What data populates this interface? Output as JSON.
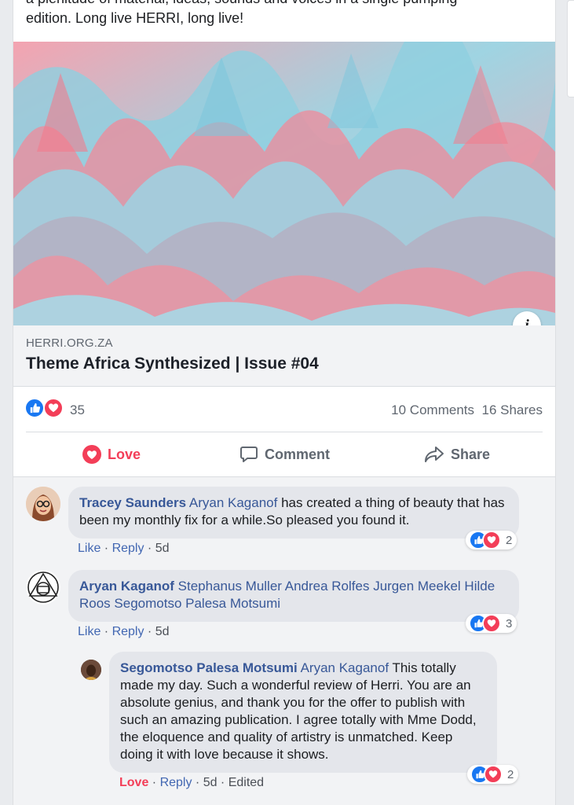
{
  "post": {
    "text_line1": "a plenitude of material, ideas, sounds and voices in a single pumping",
    "text_line2": "edition. Long live HERRI, long live!"
  },
  "link_preview": {
    "domain": "HERRI.ORG.ZA",
    "title": "Theme Africa Synthesized | Issue #04",
    "info_icon": "info-icon",
    "info_label": "i"
  },
  "stats": {
    "reaction_count": "35",
    "comments": "10 Comments",
    "shares": "16 Shares"
  },
  "actions": {
    "love": "Love",
    "comment": "Comment",
    "share": "Share"
  },
  "comments": [
    {
      "author": "Tracey Saunders",
      "tag": "Aryan Kaganof",
      "text": " has created a thing of beauty that has been my monthly fix for a while.So pleased you found it.",
      "like": "Like",
      "reply": "Reply",
      "time": "5d",
      "reaction_count": "2"
    },
    {
      "author": "Aryan Kaganof",
      "tags": "Stephanus Muller Andrea Rolfes Jurgen Meekel Hilde Roos Segomotso Palesa Motsumi",
      "like": "Like",
      "reply": "Reply",
      "time": "5d",
      "reaction_count": "3"
    },
    {
      "author": "Segomotso Palesa Motsumi",
      "tag": "Aryan Kaganof",
      "text": " This totally made my day. Such a wonderful review of Herri. You are an absolute genius, and thank you for the offer to publish with such an amazing publication. I agree totally with Mme Dodd, the eloquence and quality of artistry is unmatched. Keep doing it with love because it shows.",
      "love": "Love",
      "reply": "Reply",
      "time": "5d",
      "edited": "Edited",
      "reaction_count": "2"
    }
  ],
  "separator": " · ",
  "colors": {
    "accent_blue": "#385898",
    "like_blue": "#1877f2",
    "love_red": "#f33e58",
    "bubble_gray": "#e4e6eb"
  }
}
